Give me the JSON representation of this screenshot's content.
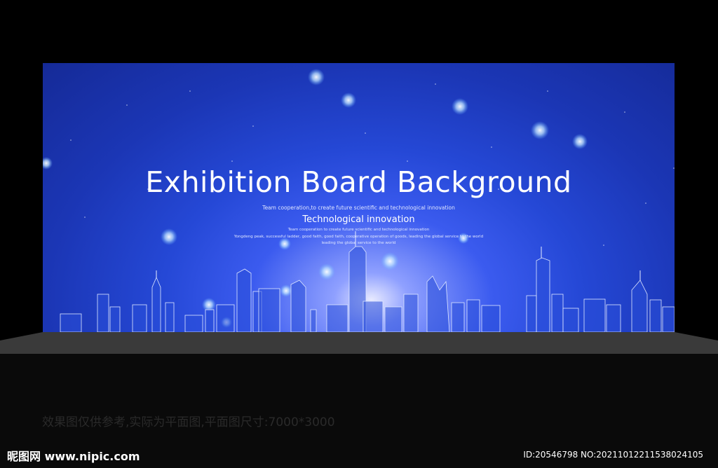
{
  "board": {
    "title": "Exhibition Board Background",
    "tagline_1": "Team cooperation,to create future scientific and technological innovation",
    "subtitle": "Technological innovation",
    "tagline_2": "Team cooperation to create future scientific and technological innovation",
    "tagline_3": "Yongdeng peak, successful ladder, good faith, good faith, cooperative operation of goods, leading the global service to the world",
    "tagline_4": "leading the global service to the world",
    "colors": {
      "background_dark": "#152a97",
      "background_mid": "#2548d6",
      "glow": "#e8eaff",
      "text": "#ffffff"
    }
  },
  "footer": {
    "disclaimer": "效果图仅供参考,实际为平面图,平面图尺寸:7000*3000",
    "logo_cn": "昵图网",
    "logo_site": "www.nipic.com",
    "image_id": "ID:20546798 NO:20211012211538024105"
  }
}
